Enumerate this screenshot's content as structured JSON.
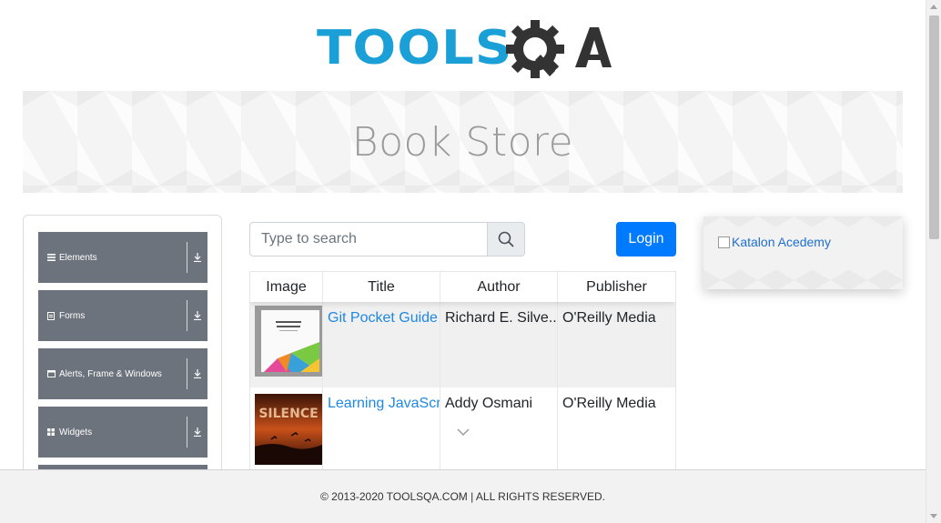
{
  "header": {
    "logo_text": "TOOLS",
    "logo_text_suffix": "QA",
    "brand_colors": {
      "blue": "#1aa0d6",
      "dark": "#333333"
    }
  },
  "banner": {
    "title": "Book Store"
  },
  "sidebar": {
    "items": [
      {
        "label": "Elements",
        "icon": "menu-lines-icon"
      },
      {
        "label": "Forms",
        "icon": "form-icon"
      },
      {
        "label": "Alerts, Frame & Windows",
        "icon": "window-icon"
      },
      {
        "label": "Widgets",
        "icon": "grid-icon"
      }
    ]
  },
  "search": {
    "placeholder": "Type to search",
    "value": ""
  },
  "login": {
    "label": "Login"
  },
  "table": {
    "headers": [
      "Image",
      "Title",
      "Author",
      "Publisher"
    ],
    "rows": [
      {
        "title": "Git Pocket Guide",
        "author": "Richard E. Silve...",
        "publisher": "O'Reilly Media"
      },
      {
        "title": "Learning JavaScript Design Patterns",
        "author": "Addy Osmani",
        "publisher": "O'Reilly Media"
      }
    ]
  },
  "ad": {
    "alt_text": "Katalon Acedemy"
  },
  "footer": {
    "text": "© 2013-2020 TOOLSQA.COM | ALL RIGHTS RESERVED."
  },
  "colors": {
    "accent": "#007bff",
    "sidebar": "#6c737c",
    "link": "#1e88e5"
  }
}
